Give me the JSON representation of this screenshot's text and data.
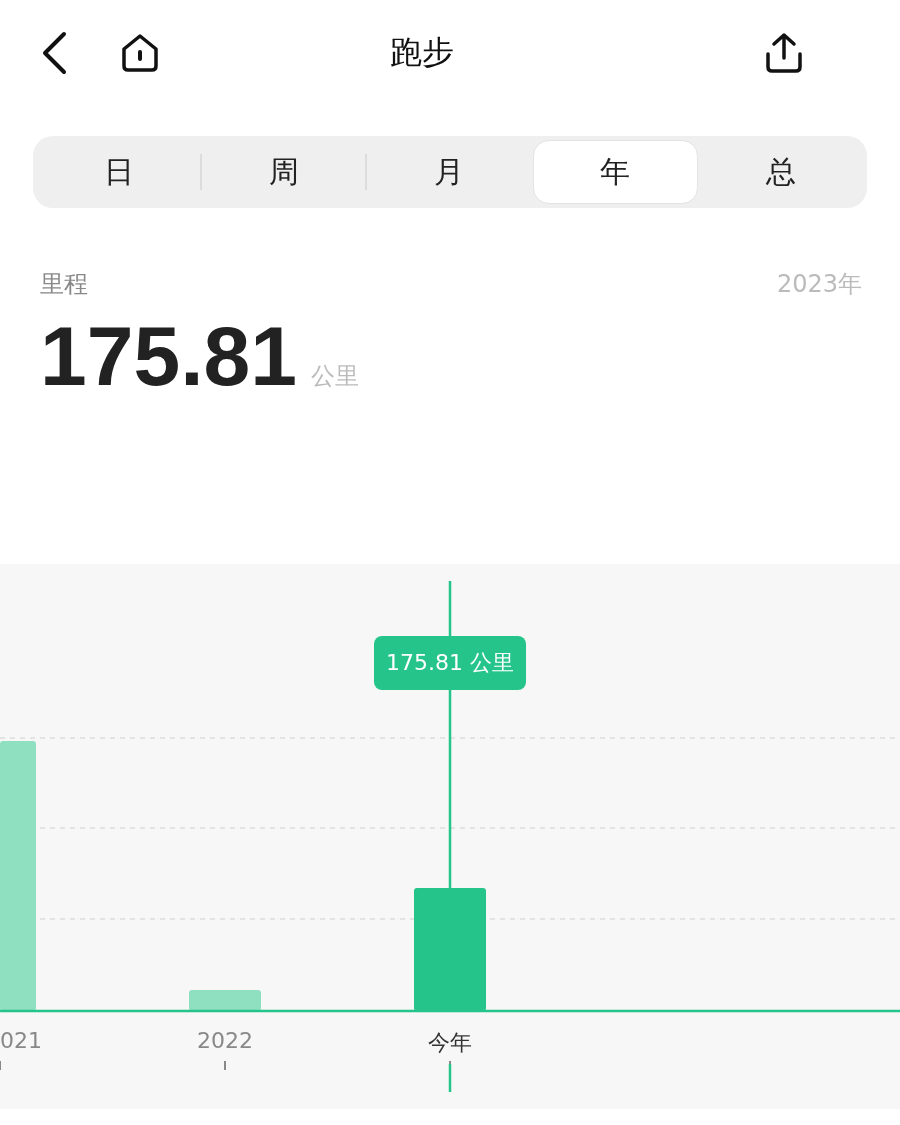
{
  "header": {
    "title": "跑步"
  },
  "tabs": [
    {
      "label": "日",
      "selected": false
    },
    {
      "label": "周",
      "selected": false
    },
    {
      "label": "月",
      "selected": false
    },
    {
      "label": "年",
      "selected": true
    },
    {
      "label": "总",
      "selected": false
    }
  ],
  "summary": {
    "label": "里程",
    "period": "2023年",
    "value": "175.81",
    "unit": "公里"
  },
  "chart": {
    "tooltip": "175.81 公里",
    "categories": [
      {
        "label": "021",
        "selected": false
      },
      {
        "label": "2022",
        "selected": false
      },
      {
        "label": "今年",
        "selected": true
      }
    ]
  }
}
